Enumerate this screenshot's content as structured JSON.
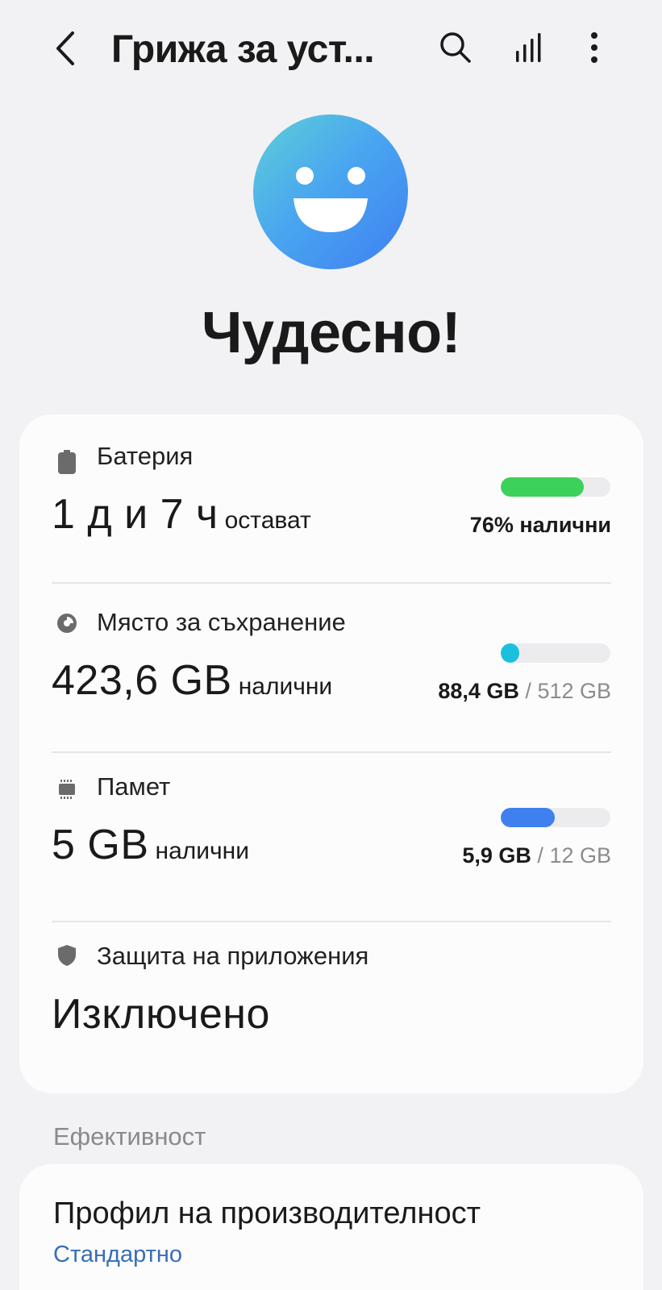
{
  "header": {
    "title": "Грижа за уст...",
    "icons": [
      "back-icon",
      "search-icon",
      "signal-chart-icon",
      "more-vertical-icon"
    ]
  },
  "status": {
    "face_icon": "smiley-face-icon",
    "title": "Чудесно!",
    "colors": {
      "gradient_start": "#5ed0d8",
      "gradient_end": "#3e7ff2"
    }
  },
  "battery": {
    "icon": "battery-icon",
    "label": "Батерия",
    "value": "1 д и 7 ч",
    "unit": "остават",
    "right_text": "76% налични",
    "level": 0.76,
    "bar_color": "#3cd15a"
  },
  "storage": {
    "icon": "storage-pie-icon",
    "label": "Място за съхранение",
    "value": "423,6 GB",
    "unit": "налични",
    "used": "88,4 GB",
    "separator": "/",
    "total": "512 GB",
    "level": 0.17,
    "bar_color": "#1bc0de"
  },
  "memory": {
    "icon": "memory-chip-icon",
    "label": "Памет",
    "value": "5 GB",
    "unit": "налични",
    "used": "5,9 GB",
    "separator": "/",
    "total": "12 GB",
    "level": 0.49,
    "bar_color": "#3f80ee"
  },
  "app_protection": {
    "icon": "shield-icon",
    "label": "Защита на приложения",
    "value": "Изключено"
  },
  "efficiency": {
    "section_label": "Ефективност",
    "profile_title": "Профил на производителност",
    "profile_value": "Стандартно"
  }
}
